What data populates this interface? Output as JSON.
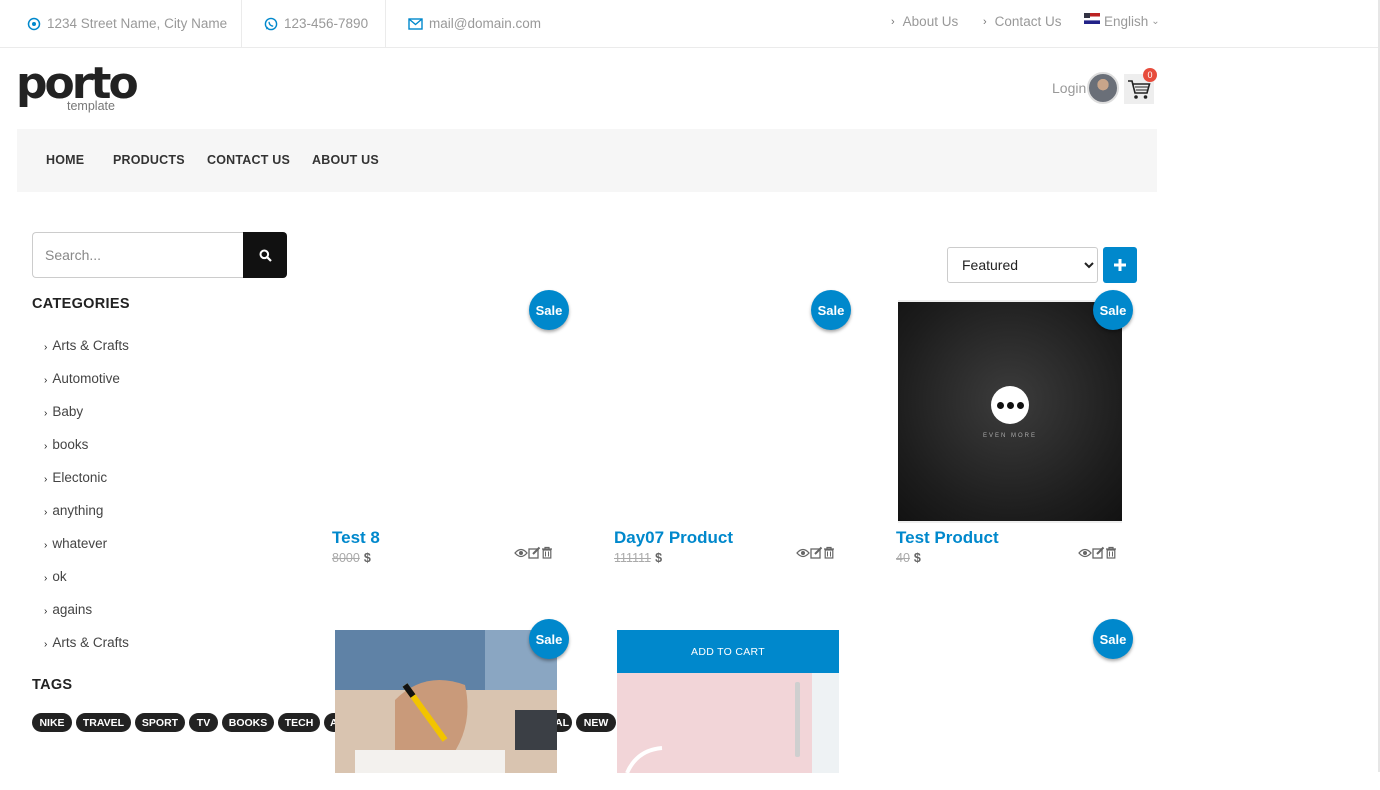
{
  "topbar": {
    "address": "1234 Street Name, City Name",
    "phone": "123-456-7890",
    "email": "mail@domain.com",
    "links": [
      "About Us",
      "Contact Us"
    ],
    "language": "English"
  },
  "header": {
    "logo_word": "porto",
    "logo_sub": "template",
    "login_label": "Login",
    "cart_count": "0"
  },
  "nav": {
    "items": [
      "HOME",
      "PRODUCTS",
      "CONTACT US",
      "ABOUT US"
    ]
  },
  "sidebar": {
    "search_placeholder": "Search...",
    "categories_title": "CATEGORIES",
    "categories": [
      "Arts & Crafts",
      "Automotive",
      "Baby",
      "books",
      "Electonic",
      "anything",
      "whatever",
      "ok",
      "agains",
      "Arts & Crafts"
    ],
    "tags_title": "TAGS",
    "tags": [
      "NIKE",
      "TRAVEL",
      "SPORT",
      "TV",
      "BOOKS",
      "TECH",
      "AL",
      "NEW"
    ]
  },
  "toolbar": {
    "sort_selected": "Featured"
  },
  "products": {
    "sale_label": "Sale",
    "add_to_cart_label": "ADD TO CART",
    "image_caption": "EVEN MORE",
    "currency": "$",
    "items": [
      {
        "name": "Test 8",
        "old_price": "8000"
      },
      {
        "name": "Day07 Product",
        "old_price": "111111"
      },
      {
        "name": "Test Product",
        "old_price": "40"
      }
    ]
  },
  "colors": {
    "accent": "#0088cc",
    "nav_bg": "#f6f6f6",
    "tag_bg": "#222222",
    "badge_red": "#e74c3c"
  }
}
